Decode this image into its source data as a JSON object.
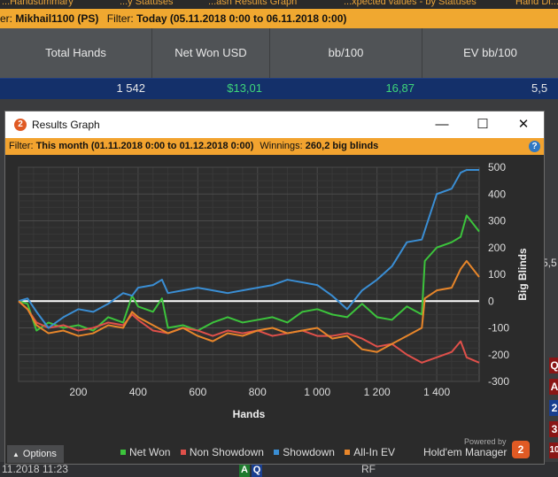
{
  "background": {
    "top_tabs": [
      "...Handsummary",
      "...y Statuses",
      "...ash Results Graph",
      "...xpected values - by Statuses",
      "Hand Di..."
    ],
    "filter": {
      "player_prefix": "er:",
      "player": "Mikhail1100 (PS)",
      "filter_label": "Filter:",
      "filter_value": "Today (05.11.2018 0:00 to 06.11.2018 0:00)"
    },
    "columns": [
      "Total Hands",
      "Net Won USD",
      "bb/100",
      "EV bb/100"
    ],
    "values": [
      "1 542",
      "$13,01",
      "16,87",
      "5,5"
    ],
    "side_value": "5,5",
    "bottom_row": {
      "date": "11.2018 11:23",
      "card1": "A",
      "card2": "Q",
      "action": "RF"
    },
    "right_badges": [
      "Q",
      "A",
      "2",
      "3",
      "10"
    ]
  },
  "window": {
    "title": "Results Graph",
    "minimize": "—",
    "maximize": "☐",
    "close": "✕",
    "filter_label": "Filter:",
    "filter_value": "This month (01.11.2018 0:00 to 01.12.2018 0:00)",
    "winnings_label": "Winnings:",
    "winnings_value": "260,2 big blinds",
    "help": "?",
    "options_label": "Options",
    "options_icon": "chevron-up-icon",
    "powered_by": "Powered by",
    "brand": "Hold'em Manager",
    "brand_logo": "2"
  },
  "chart_data": {
    "type": "line",
    "xlabel": "Hands",
    "ylabel": "Big Blinds",
    "xlim": [
      0,
      1542
    ],
    "ylim": [
      -300,
      500
    ],
    "x_ticks": [
      200,
      400,
      600,
      800,
      1000,
      1200,
      1400
    ],
    "x_tick_labels": [
      "200",
      "400",
      "600",
      "800",
      "1 000",
      "1 200",
      "1 400"
    ],
    "y_ticks": [
      500,
      400,
      300,
      200,
      100,
      0,
      -100,
      -200,
      -300
    ],
    "y_tick_labels": [
      "500",
      "400",
      "300",
      "200",
      "100",
      "0",
      "-100",
      "-200",
      "-300"
    ],
    "grid": true,
    "legend_position": "bottom",
    "series": [
      {
        "name": "Net Won",
        "color": "#3cc43c",
        "x": [
          0,
          30,
          60,
          100,
          150,
          200,
          250,
          300,
          350,
          380,
          400,
          450,
          480,
          500,
          550,
          600,
          650,
          700,
          750,
          800,
          850,
          900,
          950,
          1000,
          1050,
          1100,
          1150,
          1200,
          1250,
          1300,
          1350,
          1360,
          1400,
          1450,
          1480,
          1500,
          1542
        ],
        "y": [
          0,
          -10,
          -110,
          -80,
          -100,
          -90,
          -110,
          -60,
          -80,
          20,
          -20,
          -40,
          10,
          -100,
          -90,
          -110,
          -80,
          -60,
          -80,
          -70,
          -60,
          -80,
          -40,
          -30,
          -50,
          -60,
          -10,
          -60,
          -70,
          -20,
          -50,
          150,
          200,
          220,
          240,
          320,
          260
        ]
      },
      {
        "name": "Non Showdown",
        "color": "#e0504a",
        "x": [
          0,
          30,
          60,
          100,
          150,
          200,
          250,
          300,
          350,
          380,
          400,
          450,
          500,
          550,
          600,
          650,
          700,
          750,
          800,
          850,
          900,
          950,
          1000,
          1050,
          1100,
          1150,
          1200,
          1250,
          1300,
          1350,
          1400,
          1450,
          1480,
          1500,
          1542
        ],
        "y": [
          0,
          -30,
          -80,
          -100,
          -90,
          -110,
          -100,
          -80,
          -90,
          -50,
          -70,
          -110,
          -120,
          -100,
          -110,
          -130,
          -110,
          -120,
          -110,
          -130,
          -120,
          -110,
          -130,
          -130,
          -120,
          -140,
          -170,
          -160,
          -200,
          -230,
          -210,
          -190,
          -150,
          -210,
          -230
        ]
      },
      {
        "name": "Showdown",
        "color": "#3a8ed4",
        "x": [
          0,
          30,
          60,
          100,
          150,
          200,
          250,
          300,
          350,
          380,
          400,
          450,
          480,
          500,
          550,
          600,
          650,
          700,
          750,
          800,
          850,
          900,
          950,
          1000,
          1050,
          1100,
          1150,
          1200,
          1250,
          1300,
          1350,
          1400,
          1450,
          1480,
          1500,
          1542
        ],
        "y": [
          0,
          10,
          -40,
          -100,
          -60,
          -30,
          -40,
          -10,
          30,
          20,
          50,
          60,
          80,
          30,
          40,
          50,
          40,
          30,
          40,
          50,
          60,
          80,
          70,
          60,
          20,
          -30,
          40,
          80,
          130,
          220,
          230,
          400,
          420,
          480,
          490,
          490
        ]
      },
      {
        "name": "All-In EV",
        "color": "#e8862a",
        "x": [
          0,
          30,
          60,
          100,
          150,
          200,
          250,
          300,
          350,
          380,
          400,
          450,
          500,
          550,
          600,
          650,
          700,
          750,
          800,
          850,
          900,
          950,
          1000,
          1050,
          1100,
          1150,
          1200,
          1250,
          1300,
          1350,
          1360,
          1400,
          1450,
          1480,
          1500,
          1542
        ],
        "y": [
          0,
          -30,
          -90,
          -120,
          -110,
          -130,
          -120,
          -90,
          -100,
          -40,
          -60,
          -90,
          -120,
          -100,
          -130,
          -150,
          -120,
          -130,
          -110,
          -100,
          -120,
          -110,
          -100,
          -140,
          -130,
          -180,
          -190,
          -160,
          -130,
          -100,
          10,
          40,
          50,
          120,
          150,
          90
        ]
      }
    ]
  }
}
